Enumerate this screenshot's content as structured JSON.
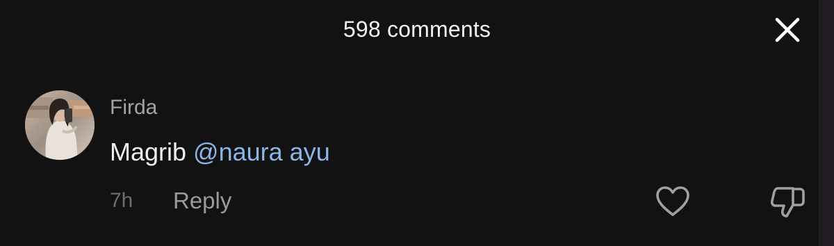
{
  "header": {
    "title": "598 comments",
    "close_icon": "close-icon"
  },
  "comment": {
    "avatar_icon": "user-avatar",
    "username": "Firda",
    "text": "Magrib ",
    "mention": "@naura ayu",
    "time": "7h",
    "reply_label": "Reply",
    "like_icon": "heart-icon",
    "dislike_icon": "thumbs-down-icon"
  },
  "colors": {
    "background": "#121212",
    "mention": "#8ab6e8",
    "username": "#a3a3a3",
    "muted": "#6d6d6d"
  }
}
